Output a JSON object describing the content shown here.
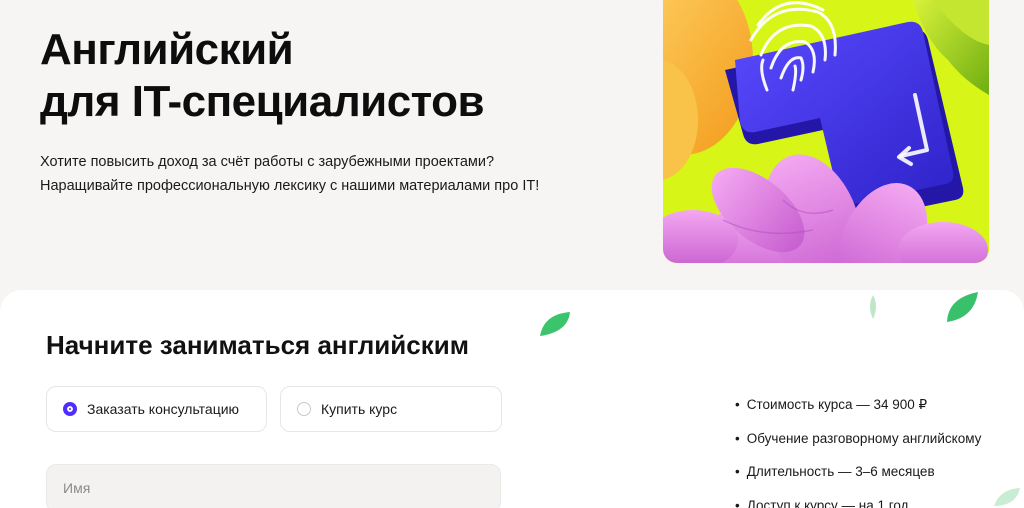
{
  "hero": {
    "title_line1": "Английский",
    "title_line2": "для IT-специалистов",
    "subtitle_line1": "Хотите повысить доход за счёт работы с зарубежными проектами?",
    "subtitle_line2": "Наращивайте профессиональную лексику с нашими материалами про IT!",
    "illustration": {
      "icon": "fingerprint-enter-key-icon",
      "colors": {
        "background": "#d7f516",
        "key": "#4135f0",
        "petals": "#e889e6",
        "orange": "#f6b52c",
        "green": "#a8d61b"
      }
    }
  },
  "form": {
    "title": "Начните заниматься английским",
    "options": [
      {
        "label": "Заказать консультацию",
        "selected": true
      },
      {
        "label": "Купить курс",
        "selected": false
      }
    ],
    "name_placeholder": "Имя"
  },
  "facts": [
    "Стоимость курса — 34 900 ₽",
    "Обучение разговорному английскому",
    "Длительность — 3–6 месяцев",
    "Доступ к курсу — на 1 год"
  ],
  "colors": {
    "accent": "#4f2dff",
    "page_bg": "#f6f5f3",
    "card_bg": "#ffffff",
    "leaf_green": "#3cc46c"
  }
}
